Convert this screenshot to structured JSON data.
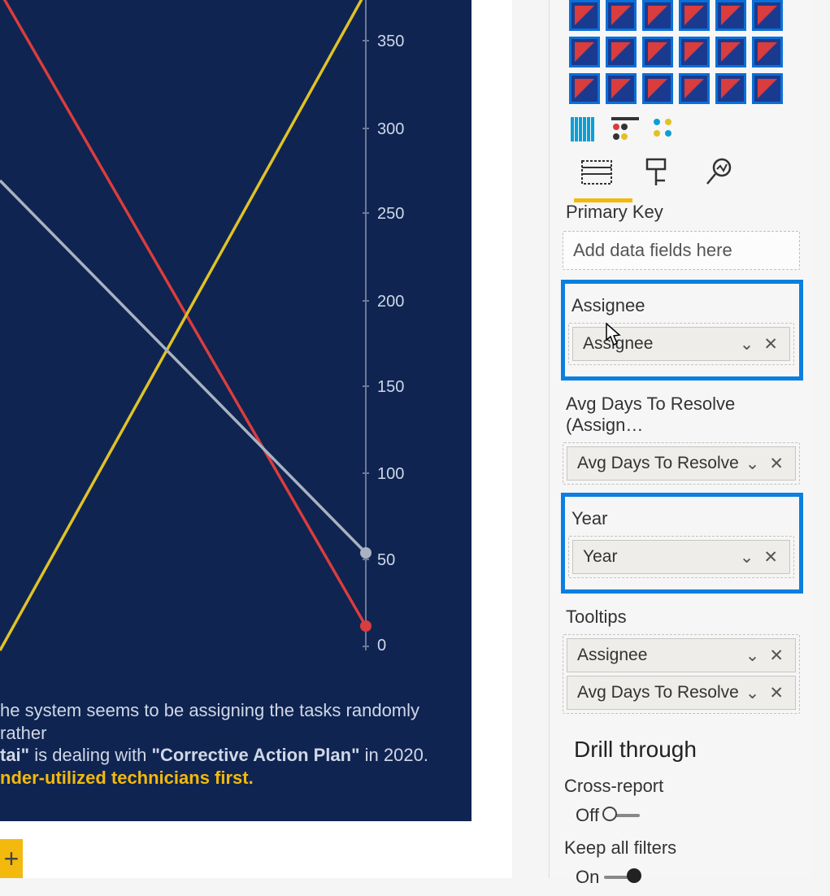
{
  "colors": {
    "chart_bg": "#0f2451",
    "line_red": "#d93d3d",
    "line_yellow": "#e0c227",
    "line_gray": "#a9b2c2",
    "highlight": "#0a7fe0",
    "accent": "#f3b90c"
  },
  "chart_data": {
    "type": "line",
    "ylabel": "",
    "ylim": [
      0,
      370
    ],
    "y_ticks": [
      0,
      50,
      100,
      150,
      200,
      250,
      300,
      350
    ],
    "x": [
      0,
      1
    ],
    "series": [
      {
        "name": "red",
        "color": "#d93d3d",
        "values": [
          370,
          10
        ]
      },
      {
        "name": "yellow",
        "color": "#e0c227",
        "values": [
          0,
          370
        ]
      },
      {
        "name": "gray",
        "color": "#a9b2c2",
        "values": [
          225,
          55
        ]
      }
    ]
  },
  "insight": {
    "line1_a": "he system seems to be assigning the tasks randomly rather",
    "line2_a": "tai\"",
    "line2_b": " is dealing with ",
    "line2_c": "\"Corrective Action Plan\"",
    "line2_d": "  in 2020.",
    "line3": "nder-utilized technicians first."
  },
  "panel": {
    "primary_key_label": "Primary Key",
    "dropzone_placeholder": "Add data fields here",
    "wells": {
      "assignee": {
        "label": "Assignee",
        "value": "Assignee"
      },
      "avg_days": {
        "label": "Avg Days To Resolve (Assign…",
        "value": "Avg Days To Resolve"
      },
      "year": {
        "label": "Year",
        "value": "Year"
      },
      "tooltips": {
        "label": "Tooltips",
        "value1": "Assignee",
        "value2": "Avg Days To Resolve"
      }
    },
    "drill": {
      "header": "Drill through",
      "cross_report_label": "Cross-report",
      "cross_report_value": "Off",
      "keep_filters_label": "Keep all filters",
      "keep_filters_value": "On"
    }
  }
}
